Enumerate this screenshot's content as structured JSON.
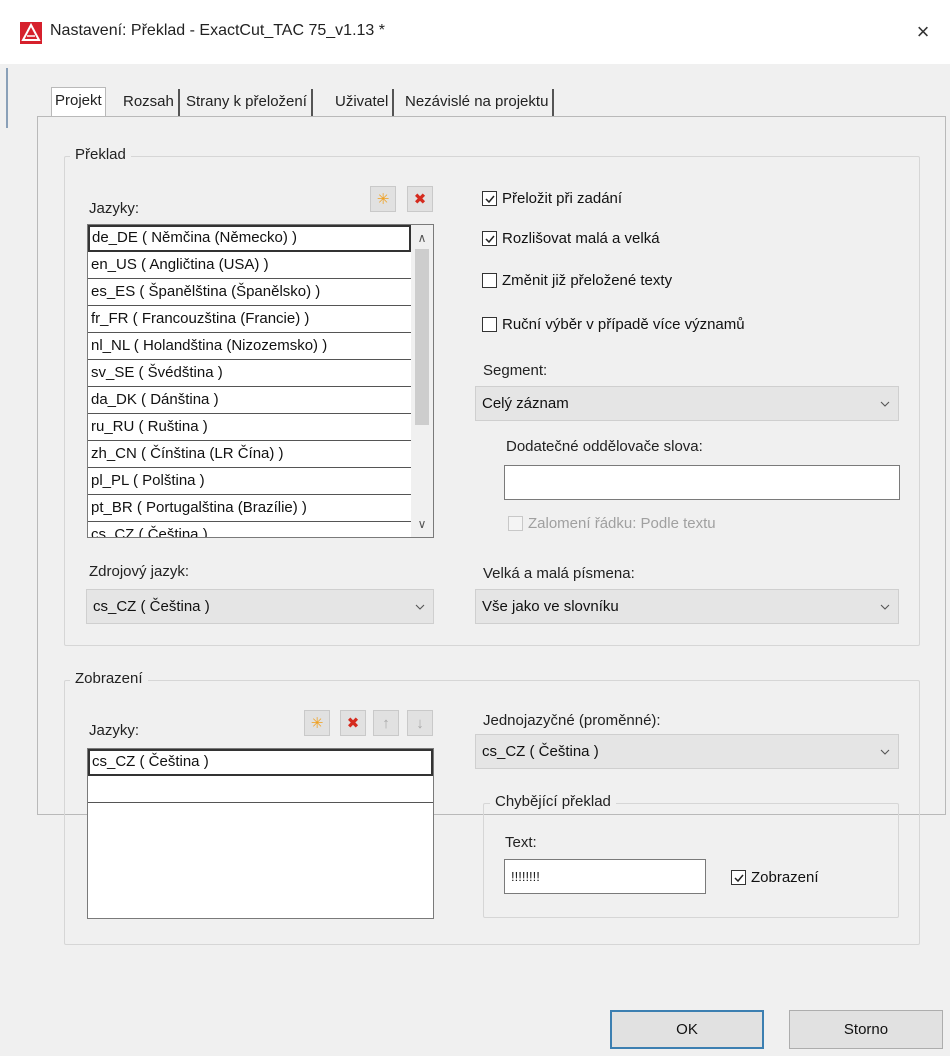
{
  "window": {
    "title": "Nastavení: Překlad - ExactCut_TAC 75_v1.13 *",
    "close_glyph": "×"
  },
  "tabs": [
    {
      "label": "Projekt"
    },
    {
      "label": "Rozsah"
    },
    {
      "label": "Strany k přeložení"
    },
    {
      "label": "Uživatel"
    },
    {
      "label": "Nezávislé na projektu"
    }
  ],
  "translation": {
    "legend": "Překlad",
    "languages_label": "Jazyky:",
    "languages": [
      "de_DE ( Němčina (Německo) )",
      "en_US ( Angličtina (USA) )",
      "es_ES ( Španělština (Španělsko) )",
      "fr_FR ( Francouzština (Francie) )",
      "nl_NL ( Holandština (Nizozemsko) )",
      "sv_SE ( Švédština )",
      "da_DK ( Dánština )",
      "ru_RU ( Ruština )",
      "zh_CN ( Čínština (LR Čína) )",
      "pl_PL ( Polština )",
      "pt_BR ( Portugalština (Brazílie) )",
      "cs_CZ ( Čeština )"
    ],
    "source_language_label": "Zdrojový jazyk:",
    "source_language_value": "cs_CZ ( Čeština )",
    "check_translate_on_input": "Přeložit při zadání",
    "check_case_sensitive": "Rozlišovat malá a velká",
    "check_change_translated": "Změnit již přeložené texty",
    "check_manual_selection": "Ruční výběr v případě více významů",
    "segment_label": "Segment:",
    "segment_value": "Celý záznam",
    "separators_label": "Dodatečné oddělovače slova:",
    "separators_value": "",
    "line_break_label": "Zalomení řádku: Podle textu",
    "case_label": "Velká a malá písmena:",
    "case_value": "Vše jako ve slovníku"
  },
  "display": {
    "legend": "Zobrazení",
    "languages_label": "Jazyky:",
    "languages": [
      "cs_CZ ( Čeština )",
      ""
    ],
    "monolingual_label": "Jednojazyčné (proměnné):",
    "monolingual_value": "cs_CZ ( Čeština )",
    "missing_legend": "Chybějící  překlad",
    "text_label": "Text:",
    "text_value": "!!!!!!!!",
    "show_label": "Zobrazení"
  },
  "checkbox_states": {
    "translate_on_input": true,
    "case_sensitive": true,
    "change_translated": false,
    "manual_selection": false,
    "line_break": false,
    "show_missing": true
  },
  "buttons": {
    "ok": "OK",
    "cancel": "Storno"
  },
  "icons": {
    "add": "star-icon",
    "remove": "delete-icon",
    "up": "arrow-up-icon",
    "down": "arrow-down-icon",
    "app": "app-logo-icon"
  },
  "colors": {
    "accent_red": "#d6202c",
    "default_button_border": "#3c7fb1"
  }
}
